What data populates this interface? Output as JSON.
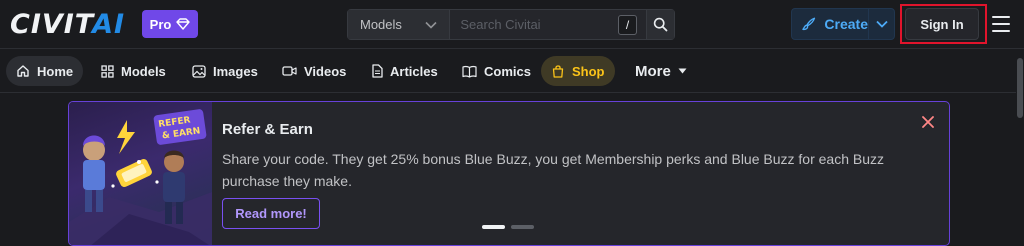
{
  "brand": {
    "logo_main": "CIVIT",
    "logo_ai": "AI",
    "pro_label": "Pro"
  },
  "search": {
    "category": "Models",
    "placeholder": "Search Civitai",
    "shortcut": "/"
  },
  "header": {
    "create_label": "Create",
    "signin_label": "Sign In"
  },
  "nav": {
    "items": [
      {
        "label": "Home",
        "icon": "home-icon"
      },
      {
        "label": "Models",
        "icon": "grid-icon"
      },
      {
        "label": "Images",
        "icon": "photo-icon"
      },
      {
        "label": "Videos",
        "icon": "video-icon"
      },
      {
        "label": "Articles",
        "icon": "file-text-icon"
      },
      {
        "label": "Comics",
        "icon": "book-icon"
      },
      {
        "label": "Shop",
        "icon": "shopping-bag-icon"
      },
      {
        "label": "More",
        "icon": "caret-down-icon"
      }
    ]
  },
  "banner": {
    "title": "Refer & Earn",
    "text": "Share your code. They get 25% bonus Blue Buzz, you get Membership perks and Blue Buzz for each Buzz purchase they make.",
    "button": "Read more!",
    "image_text_1": "REFER",
    "image_text_2": "& EARN",
    "active_slide": 1,
    "slide_count": 2
  },
  "colors": {
    "accent": "#7048e8",
    "link": "#4dabf7",
    "shop": "#fcc419",
    "highlight_frame": "#e0142c"
  }
}
